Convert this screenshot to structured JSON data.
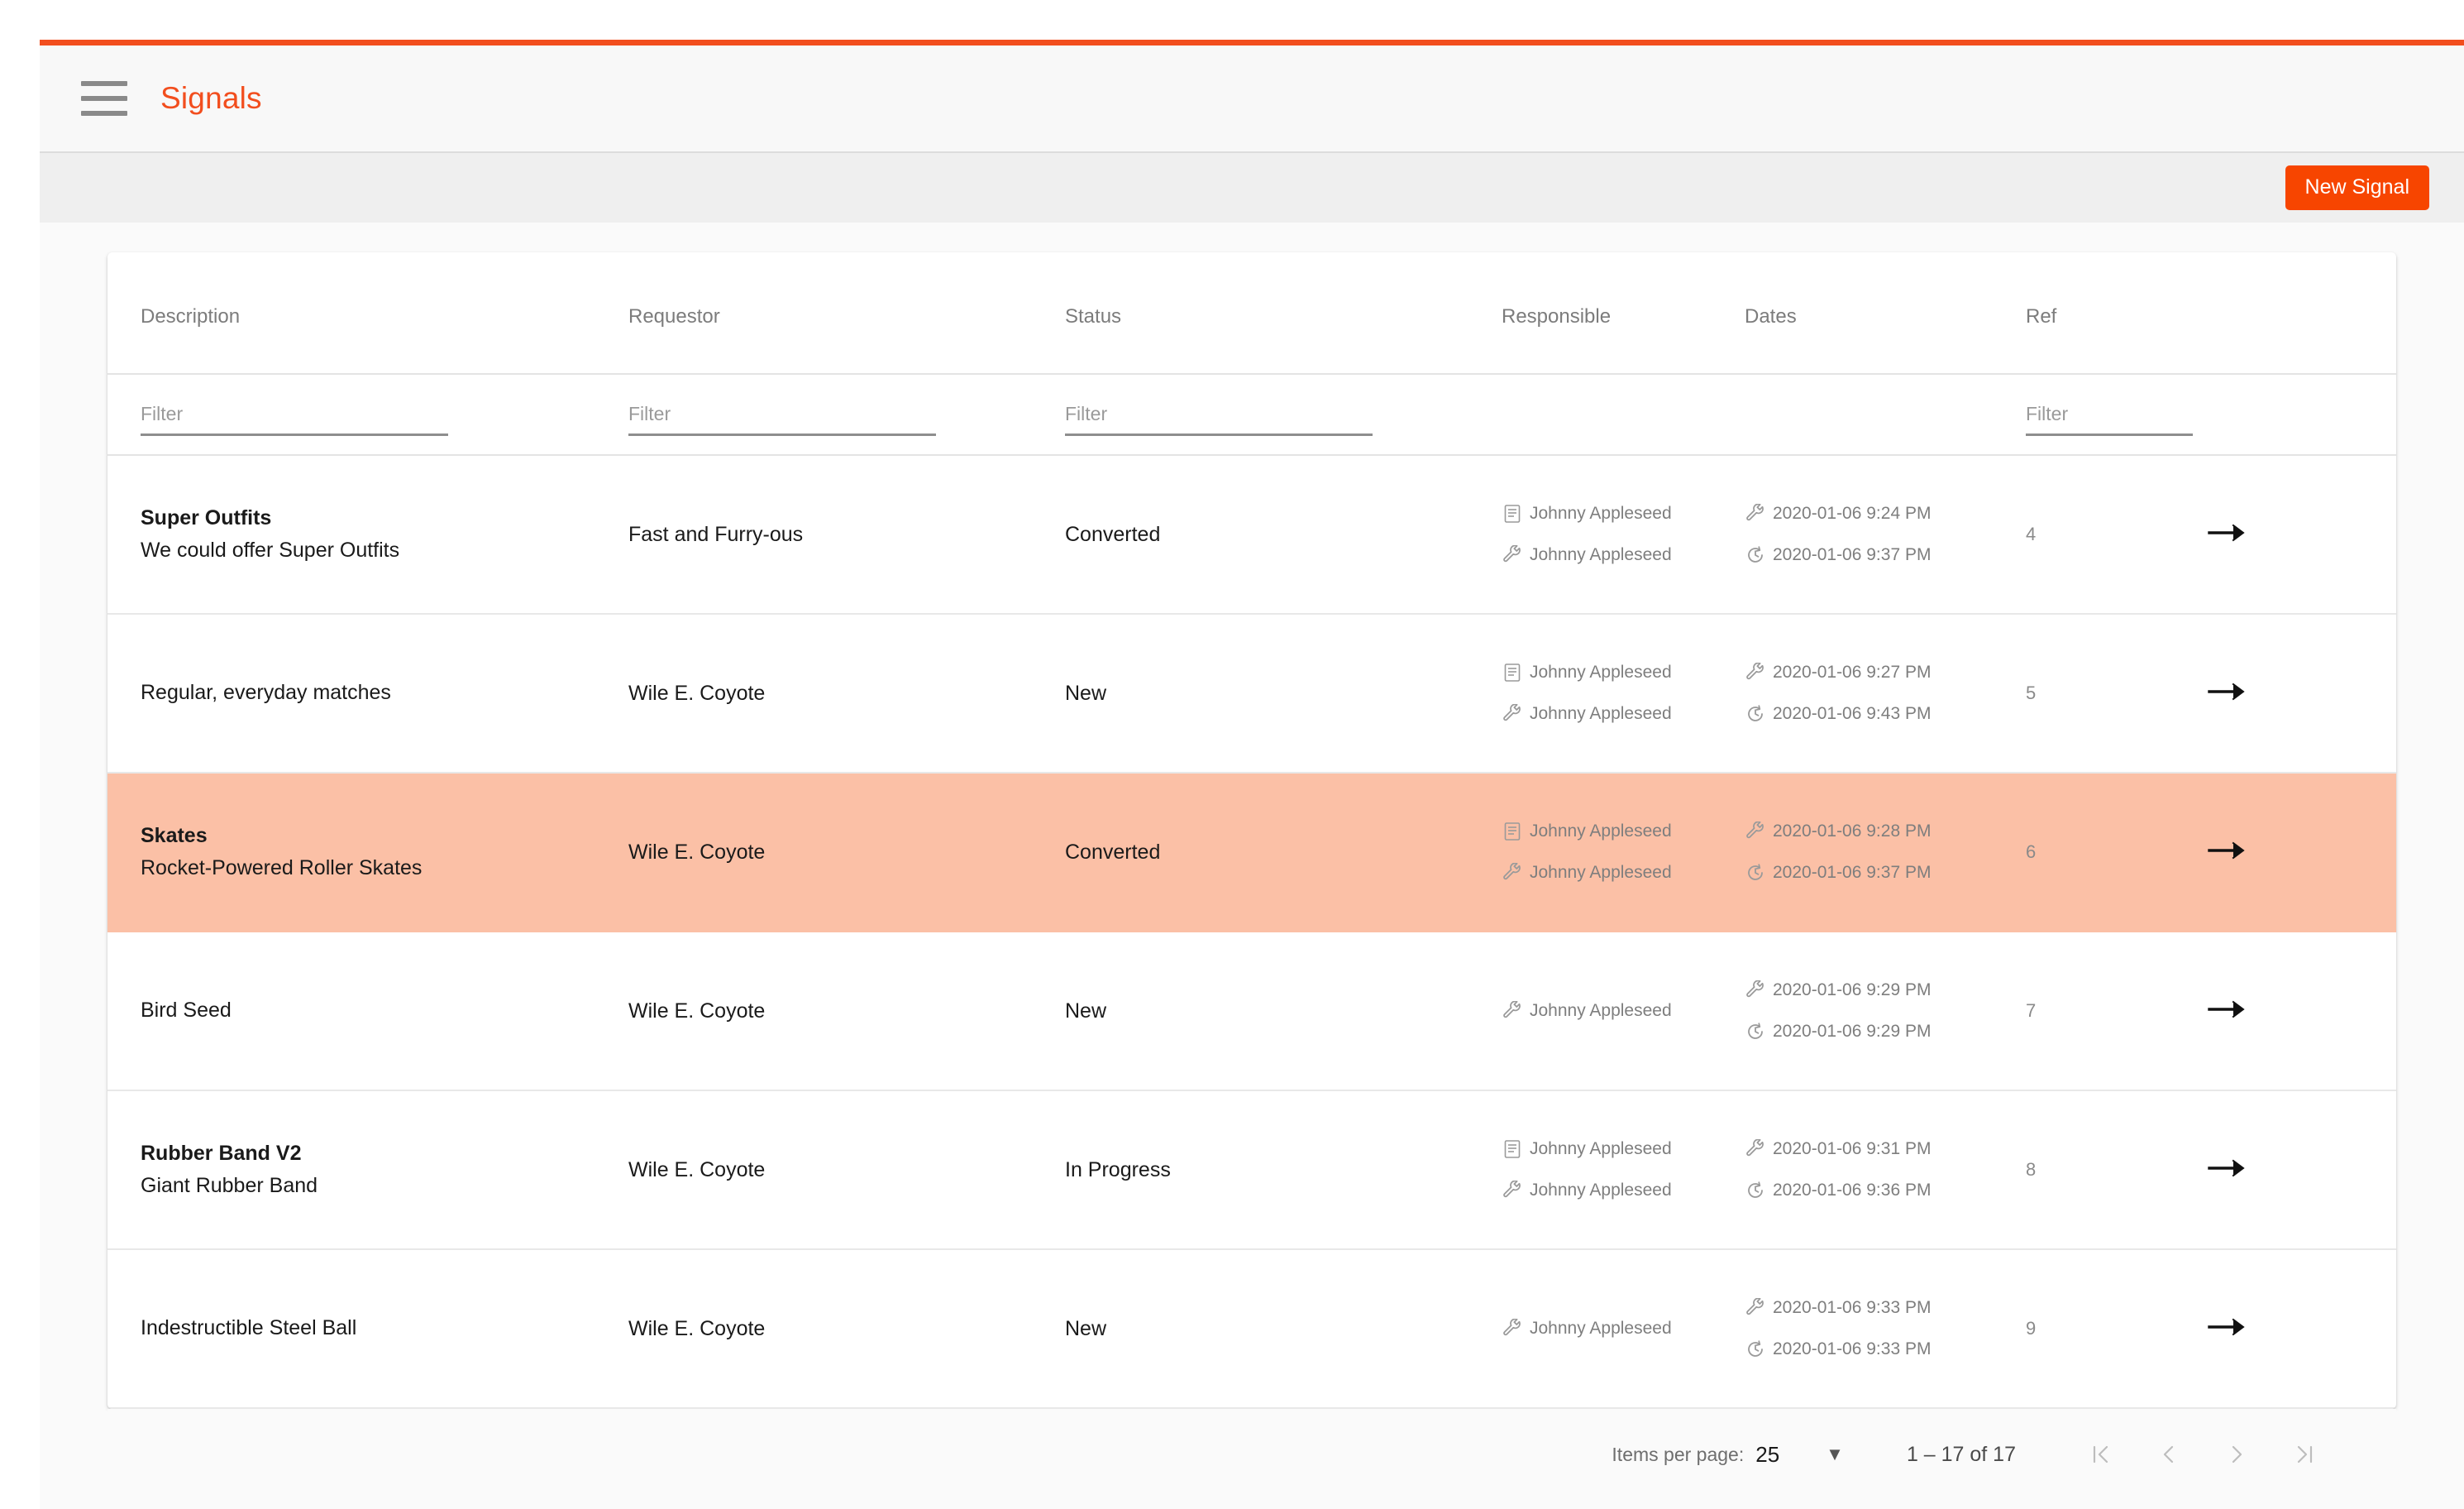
{
  "header": {
    "menu_icon": "hamburger-menu-icon",
    "title": "Signals"
  },
  "action_bar": {
    "new_signal_label": "New Signal"
  },
  "colors": {
    "accent": "#F24E1E",
    "button": "#F74500",
    "row_highlight": "#FBC0A6"
  },
  "table": {
    "columns": [
      {
        "key": "description",
        "label": "Description",
        "filter_placeholder": "Filter"
      },
      {
        "key": "requestor",
        "label": "Requestor",
        "filter_placeholder": "Filter"
      },
      {
        "key": "status",
        "label": "Status",
        "filter_placeholder": "Filter"
      },
      {
        "key": "responsible",
        "label": "Responsible",
        "filter_placeholder": ""
      },
      {
        "key": "dates",
        "label": "Dates",
        "filter_placeholder": ""
      },
      {
        "key": "ref",
        "label": "Ref",
        "filter_placeholder": "Filter"
      }
    ],
    "filters": {
      "description": "",
      "requestor": "",
      "status": "",
      "ref": ""
    },
    "rows": [
      {
        "title": "Super Outfits",
        "subtitle": "We could offer Super Outfits",
        "requestor": "Fast and Furry-ous",
        "status": "Converted",
        "responsible": [
          {
            "icon": "document-icon",
            "name": "Johnny Appleseed"
          },
          {
            "icon": "wrench-icon",
            "name": "Johnny Appleseed"
          }
        ],
        "dates": [
          {
            "icon": "wrench-icon",
            "value": "2020-01-06 9:24 PM"
          },
          {
            "icon": "clock-refresh-icon",
            "value": "2020-01-06 9:37 PM"
          }
        ],
        "ref": "4",
        "action_icon": "arrow-right-icon",
        "highlighted": false
      },
      {
        "title": "",
        "subtitle": "Regular, everyday matches",
        "requestor": "Wile E. Coyote",
        "status": "New",
        "responsible": [
          {
            "icon": "document-icon",
            "name": "Johnny Appleseed"
          },
          {
            "icon": "wrench-icon",
            "name": "Johnny Appleseed"
          }
        ],
        "dates": [
          {
            "icon": "wrench-icon",
            "value": "2020-01-06 9:27 PM"
          },
          {
            "icon": "clock-refresh-icon",
            "value": "2020-01-06 9:43 PM"
          }
        ],
        "ref": "5",
        "action_icon": "arrow-right-icon",
        "highlighted": false
      },
      {
        "title": "Skates",
        "subtitle": "Rocket-Powered Roller Skates",
        "requestor": "Wile E. Coyote",
        "status": "Converted",
        "responsible": [
          {
            "icon": "document-icon",
            "name": "Johnny Appleseed"
          },
          {
            "icon": "wrench-icon",
            "name": "Johnny Appleseed"
          }
        ],
        "dates": [
          {
            "icon": "wrench-icon",
            "value": "2020-01-06 9:28 PM"
          },
          {
            "icon": "clock-refresh-icon",
            "value": "2020-01-06 9:37 PM"
          }
        ],
        "ref": "6",
        "action_icon": "arrow-right-icon",
        "highlighted": true
      },
      {
        "title": "",
        "subtitle": "Bird Seed",
        "requestor": "Wile E. Coyote",
        "status": "New",
        "responsible": [
          {
            "icon": "wrench-icon",
            "name": "Johnny Appleseed"
          }
        ],
        "dates": [
          {
            "icon": "wrench-icon",
            "value": "2020-01-06 9:29 PM"
          },
          {
            "icon": "clock-refresh-icon",
            "value": "2020-01-06 9:29 PM"
          }
        ],
        "ref": "7",
        "action_icon": "arrow-right-icon",
        "highlighted": false
      },
      {
        "title": "Rubber Band V2",
        "subtitle": "Giant Rubber Band",
        "requestor": "Wile E. Coyote",
        "status": "In Progress",
        "responsible": [
          {
            "icon": "document-icon",
            "name": "Johnny Appleseed"
          },
          {
            "icon": "wrench-icon",
            "name": "Johnny Appleseed"
          }
        ],
        "dates": [
          {
            "icon": "wrench-icon",
            "value": "2020-01-06 9:31 PM"
          },
          {
            "icon": "clock-refresh-icon",
            "value": "2020-01-06 9:36 PM"
          }
        ],
        "ref": "8",
        "action_icon": "arrow-right-icon",
        "highlighted": false
      },
      {
        "title": "",
        "subtitle": "Indestructible Steel Ball",
        "requestor": "Wile E. Coyote",
        "status": "New",
        "responsible": [
          {
            "icon": "wrench-icon",
            "name": "Johnny Appleseed"
          }
        ],
        "dates": [
          {
            "icon": "wrench-icon",
            "value": "2020-01-06 9:33 PM"
          },
          {
            "icon": "clock-refresh-icon",
            "value": "2020-01-06 9:33 PM"
          }
        ],
        "ref": "9",
        "action_icon": "arrow-right-icon",
        "highlighted": false
      }
    ]
  },
  "paginator": {
    "items_per_page_label": "Items per page:",
    "items_per_page_value": "25",
    "range_label": "1 – 17 of 17",
    "first_page_icon": "first-page-icon",
    "prev_page_icon": "previous-page-icon",
    "next_page_icon": "next-page-icon",
    "last_page_icon": "last-page-icon"
  }
}
